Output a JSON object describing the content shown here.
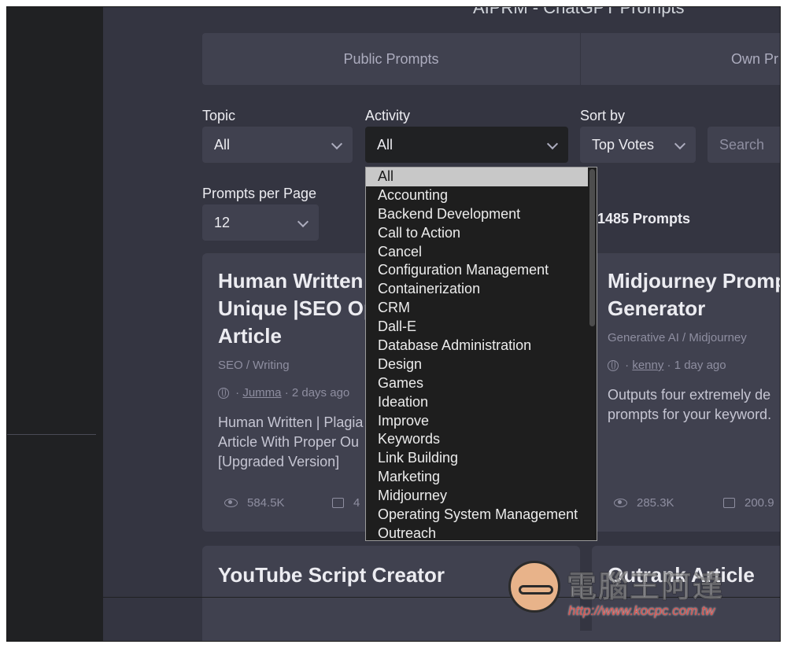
{
  "page": {
    "title": "AIPRM - ChatGPT Prompts"
  },
  "tabs": {
    "public": "Public Prompts",
    "own": "Own Pr"
  },
  "filters": {
    "topic": {
      "label": "Topic",
      "value": "All"
    },
    "activity": {
      "label": "Activity",
      "value": "All"
    },
    "sort": {
      "label": "Sort by",
      "value": "Top Votes"
    },
    "search": {
      "placeholder": "Search"
    },
    "per_page": {
      "label": "Prompts per Page",
      "value": "12"
    }
  },
  "results": {
    "count": "1485 Prompts"
  },
  "activity_options": [
    "All",
    "Accounting",
    "Backend Development",
    "Call to Action",
    "Cancel",
    "Configuration Management",
    "Containerization",
    "CRM",
    "Dall-E",
    "Database Administration",
    "Design",
    "Games",
    "Ideation",
    "Improve",
    "Keywords",
    "Link Building",
    "Marketing",
    "Midjourney",
    "Operating System Management",
    "Outreach"
  ],
  "cards": [
    {
      "title_lines": [
        "Human Written",
        "Unique |SEO Op",
        "Article"
      ],
      "category": "SEO / Writing",
      "author": "Jumma",
      "time": "· 2 days ago",
      "desc_lines": [
        "Human Written | Plagia",
        "Article With Proper Ou",
        "[Upgraded Version]"
      ],
      "views": "584.5K",
      "comments": "4"
    },
    {
      "title_lines": [
        "Midjourney Promp",
        "Generator"
      ],
      "category": "Generative AI / Midjourney",
      "author": "kenny",
      "time": "· 1 day ago",
      "desc_lines": [
        "Outputs four extremely de",
        "prompts for your keyword."
      ],
      "views": "285.3K",
      "comments": "200.9"
    },
    {
      "title": "YouTube Script Creator"
    },
    {
      "title": "Outrank Article"
    }
  ],
  "watermark": {
    "text": "電腦王阿達",
    "url": "http://www.kocpc.com.tw"
  }
}
